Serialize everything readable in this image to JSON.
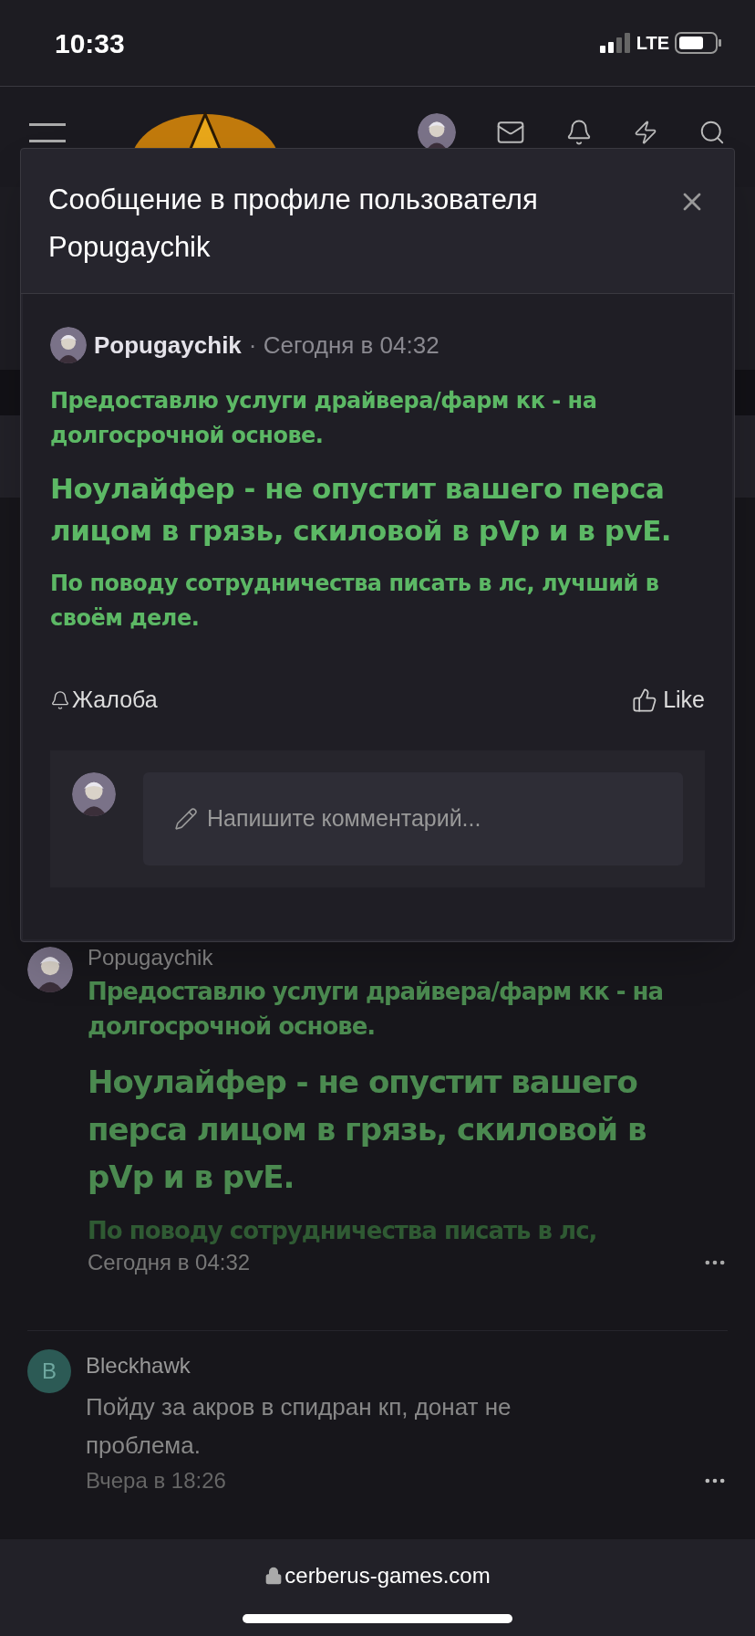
{
  "status_bar": {
    "time": "10:33",
    "network": "LTE"
  },
  "modal": {
    "title": "Сообщение в профиле пользователя Popugaychik",
    "post": {
      "author": "Popugaychik",
      "time": "· Сегодня в 04:32",
      "paragraphs": [
        {
          "kind": "normal",
          "text": "Предоставлю услуги драйвера/фарм кк - на долгосрочной основе."
        },
        {
          "kind": "large",
          "text": "Ноулайфер - не опустит вашего перса лицом в грязь, скиловой в pVp и в pvE."
        },
        {
          "kind": "normal",
          "text": "По поводу сотрудничества писать в лс, лучший в своём деле."
        }
      ]
    },
    "report": "Жалоба",
    "like": "Like",
    "comment": {
      "placeholder": "Напишите комментарий..."
    }
  },
  "background_post": {
    "author": "Popugaychik",
    "paragraphs": [
      {
        "kind": "normal",
        "text": "Предоставлю услуги драйвера/фарм кк - на долгосрочной основе."
      },
      {
        "kind": "large",
        "text": "Ноулайфер - не опустит вашего перса лицом в грязь, скиловой в pVp и в pvE."
      },
      {
        "kind": "faded",
        "text": "По поводу сотрудничества писать в лс,"
      }
    ],
    "time": "Сегодня в 04:32"
  },
  "comments": [
    {
      "initial": "B",
      "color": "#2c5a55",
      "author": "Bleckhawk",
      "text": "Пойду за акров в спидран кп, донат не проблема.",
      "time": "Вчера в 18:26"
    }
  ],
  "url": "cerberus-games.com"
}
